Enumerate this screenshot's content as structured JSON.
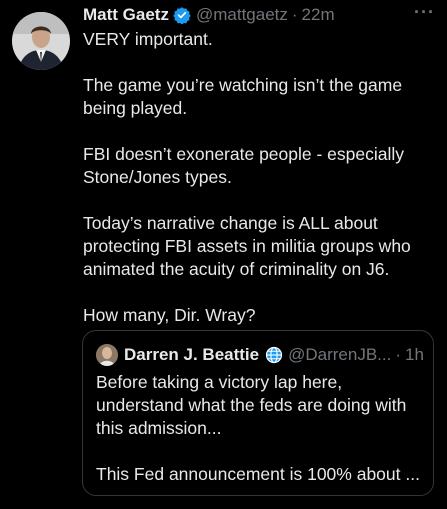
{
  "tweet": {
    "author_name": "Matt Gaetz",
    "handle": "@mattgaetz",
    "separator": "·",
    "time": "22m",
    "more": "···",
    "paragraphs": [
      "VERY important.",
      "The game you’re watching isn’t the game\nbeing played.",
      "FBI doesn’t exonerate people - especially\nStone/Jones types.",
      "Today’s narrative change is ALL about\nprotecting FBI assets in militia groups who\nanimated the acuity of criminality on J6.",
      "How many, Dir. Wray?"
    ]
  },
  "quote": {
    "author_name": "Darren J. Beattie",
    "handle": "@DarrenJB...",
    "separator": "·",
    "time": "1h",
    "paragraphs": [
      "Before taking a victory lap here,\nunderstand what the feds are doing with\nthis admission...",
      "This Fed announcement is 100% about ..."
    ]
  },
  "icons": {
    "verified": "verified-badge-icon",
    "globe": "globe-icon",
    "more": "more-options-icon"
  },
  "colors": {
    "background": "#000000",
    "text": "#e7e9ea",
    "muted": "#71767b",
    "border": "#333639",
    "verified_blue": "#1d9bf0"
  }
}
